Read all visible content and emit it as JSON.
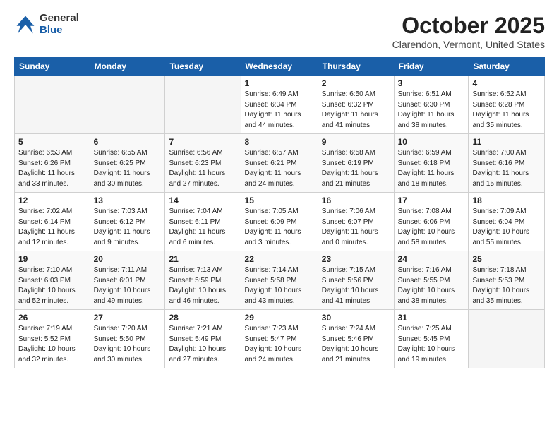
{
  "header": {
    "logo_general": "General",
    "logo_blue": "Blue",
    "month_title": "October 2025",
    "location": "Clarendon, Vermont, United States"
  },
  "weekdays": [
    "Sunday",
    "Monday",
    "Tuesday",
    "Wednesday",
    "Thursday",
    "Friday",
    "Saturday"
  ],
  "rows": [
    [
      {
        "day": "",
        "info": ""
      },
      {
        "day": "",
        "info": ""
      },
      {
        "day": "",
        "info": ""
      },
      {
        "day": "1",
        "info": "Sunrise: 6:49 AM\nSunset: 6:34 PM\nDaylight: 11 hours\nand 44 minutes."
      },
      {
        "day": "2",
        "info": "Sunrise: 6:50 AM\nSunset: 6:32 PM\nDaylight: 11 hours\nand 41 minutes."
      },
      {
        "day": "3",
        "info": "Sunrise: 6:51 AM\nSunset: 6:30 PM\nDaylight: 11 hours\nand 38 minutes."
      },
      {
        "day": "4",
        "info": "Sunrise: 6:52 AM\nSunset: 6:28 PM\nDaylight: 11 hours\nand 35 minutes."
      }
    ],
    [
      {
        "day": "5",
        "info": "Sunrise: 6:53 AM\nSunset: 6:26 PM\nDaylight: 11 hours\nand 33 minutes."
      },
      {
        "day": "6",
        "info": "Sunrise: 6:55 AM\nSunset: 6:25 PM\nDaylight: 11 hours\nand 30 minutes."
      },
      {
        "day": "7",
        "info": "Sunrise: 6:56 AM\nSunset: 6:23 PM\nDaylight: 11 hours\nand 27 minutes."
      },
      {
        "day": "8",
        "info": "Sunrise: 6:57 AM\nSunset: 6:21 PM\nDaylight: 11 hours\nand 24 minutes."
      },
      {
        "day": "9",
        "info": "Sunrise: 6:58 AM\nSunset: 6:19 PM\nDaylight: 11 hours\nand 21 minutes."
      },
      {
        "day": "10",
        "info": "Sunrise: 6:59 AM\nSunset: 6:18 PM\nDaylight: 11 hours\nand 18 minutes."
      },
      {
        "day": "11",
        "info": "Sunrise: 7:00 AM\nSunset: 6:16 PM\nDaylight: 11 hours\nand 15 minutes."
      }
    ],
    [
      {
        "day": "12",
        "info": "Sunrise: 7:02 AM\nSunset: 6:14 PM\nDaylight: 11 hours\nand 12 minutes."
      },
      {
        "day": "13",
        "info": "Sunrise: 7:03 AM\nSunset: 6:12 PM\nDaylight: 11 hours\nand 9 minutes."
      },
      {
        "day": "14",
        "info": "Sunrise: 7:04 AM\nSunset: 6:11 PM\nDaylight: 11 hours\nand 6 minutes."
      },
      {
        "day": "15",
        "info": "Sunrise: 7:05 AM\nSunset: 6:09 PM\nDaylight: 11 hours\nand 3 minutes."
      },
      {
        "day": "16",
        "info": "Sunrise: 7:06 AM\nSunset: 6:07 PM\nDaylight: 11 hours\nand 0 minutes."
      },
      {
        "day": "17",
        "info": "Sunrise: 7:08 AM\nSunset: 6:06 PM\nDaylight: 10 hours\nand 58 minutes."
      },
      {
        "day": "18",
        "info": "Sunrise: 7:09 AM\nSunset: 6:04 PM\nDaylight: 10 hours\nand 55 minutes."
      }
    ],
    [
      {
        "day": "19",
        "info": "Sunrise: 7:10 AM\nSunset: 6:03 PM\nDaylight: 10 hours\nand 52 minutes."
      },
      {
        "day": "20",
        "info": "Sunrise: 7:11 AM\nSunset: 6:01 PM\nDaylight: 10 hours\nand 49 minutes."
      },
      {
        "day": "21",
        "info": "Sunrise: 7:13 AM\nSunset: 5:59 PM\nDaylight: 10 hours\nand 46 minutes."
      },
      {
        "day": "22",
        "info": "Sunrise: 7:14 AM\nSunset: 5:58 PM\nDaylight: 10 hours\nand 43 minutes."
      },
      {
        "day": "23",
        "info": "Sunrise: 7:15 AM\nSunset: 5:56 PM\nDaylight: 10 hours\nand 41 minutes."
      },
      {
        "day": "24",
        "info": "Sunrise: 7:16 AM\nSunset: 5:55 PM\nDaylight: 10 hours\nand 38 minutes."
      },
      {
        "day": "25",
        "info": "Sunrise: 7:18 AM\nSunset: 5:53 PM\nDaylight: 10 hours\nand 35 minutes."
      }
    ],
    [
      {
        "day": "26",
        "info": "Sunrise: 7:19 AM\nSunset: 5:52 PM\nDaylight: 10 hours\nand 32 minutes."
      },
      {
        "day": "27",
        "info": "Sunrise: 7:20 AM\nSunset: 5:50 PM\nDaylight: 10 hours\nand 30 minutes."
      },
      {
        "day": "28",
        "info": "Sunrise: 7:21 AM\nSunset: 5:49 PM\nDaylight: 10 hours\nand 27 minutes."
      },
      {
        "day": "29",
        "info": "Sunrise: 7:23 AM\nSunset: 5:47 PM\nDaylight: 10 hours\nand 24 minutes."
      },
      {
        "day": "30",
        "info": "Sunrise: 7:24 AM\nSunset: 5:46 PM\nDaylight: 10 hours\nand 21 minutes."
      },
      {
        "day": "31",
        "info": "Sunrise: 7:25 AM\nSunset: 5:45 PM\nDaylight: 10 hours\nand 19 minutes."
      },
      {
        "day": "",
        "info": ""
      }
    ]
  ]
}
